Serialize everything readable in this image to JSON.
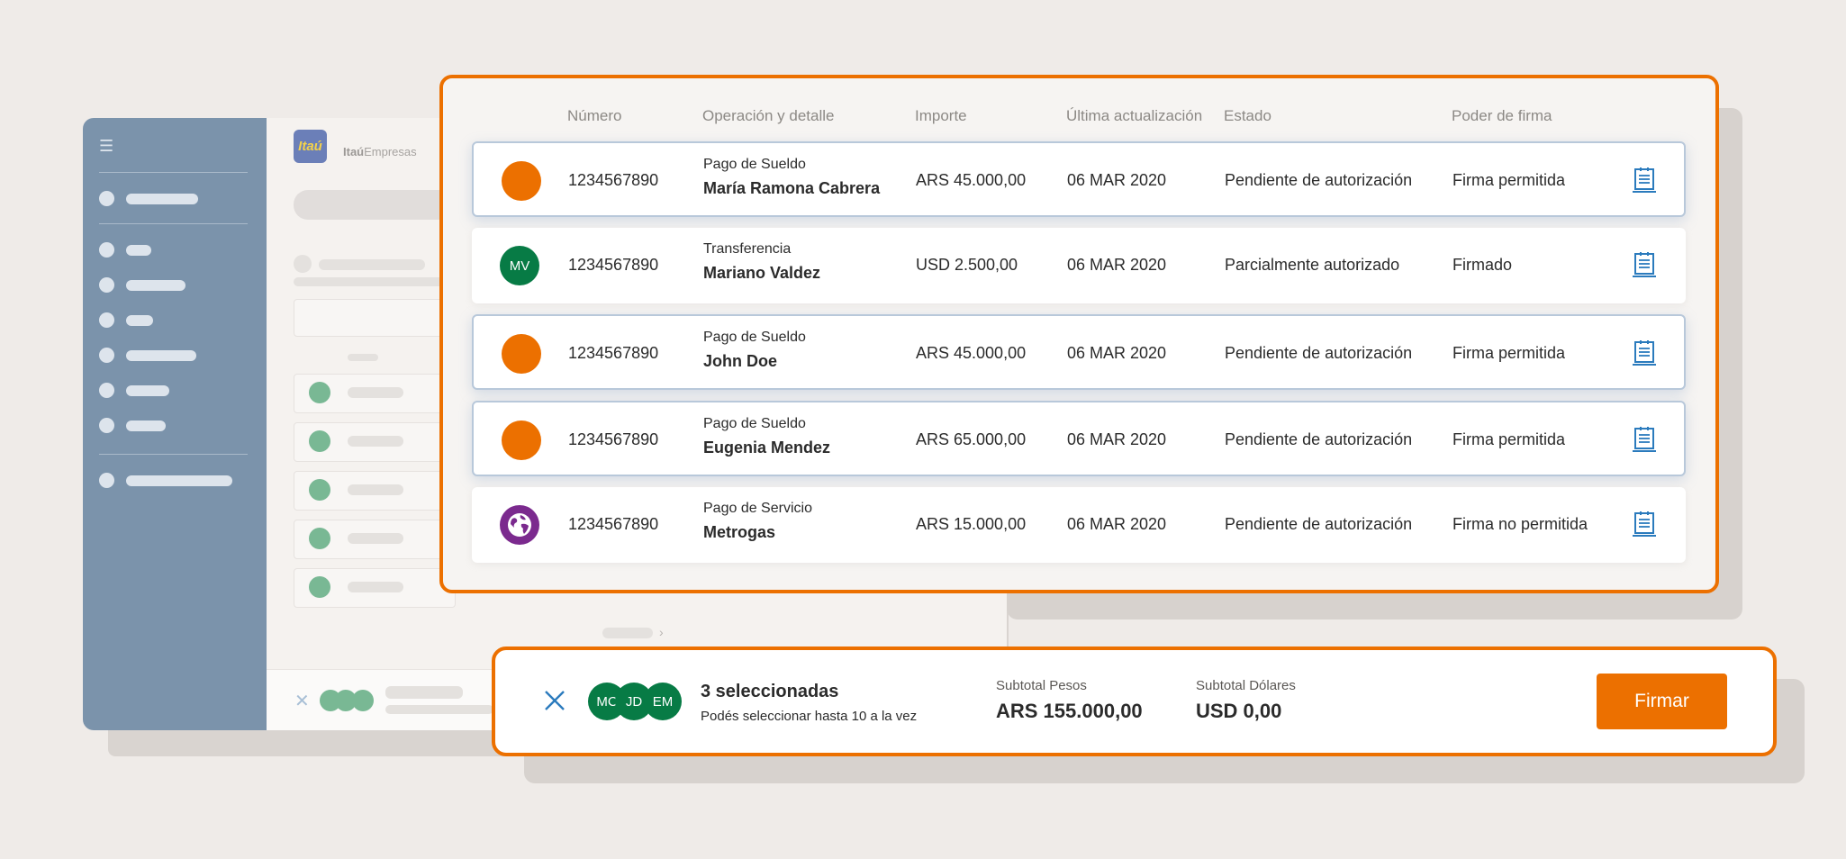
{
  "colors": {
    "brand_orange": "#ec7000",
    "avatar_green": "#077b45",
    "avatar_purple": "#7b2a8e",
    "link_blue": "#2b7bbd",
    "sidebar_blue": "#7b93ab"
  },
  "background_app": {
    "menu_icon": "hamburger-icon",
    "logo": "Itaú",
    "brand_text_bold": "Itaú",
    "brand_text": "Empresas"
  },
  "table": {
    "headers": [
      "Número",
      "Operación y detalle",
      "Importe",
      "Última actualización",
      "Estado",
      "Poder de firma"
    ],
    "rows": [
      {
        "selected": true,
        "avatar": "",
        "avatar_color": "orange",
        "numero": "1234567890",
        "operacion": "Pago de Sueldo",
        "detalle": "María Ramona Cabrera",
        "importe": "ARS 45.000,00",
        "fecha": "06 MAR 2020",
        "estado": "Pendiente de autorización",
        "poder": "Firma permitida",
        "icon": "document-icon"
      },
      {
        "selected": false,
        "avatar": "MV",
        "avatar_color": "green",
        "numero": "1234567890",
        "operacion": "Transferencia",
        "detalle": "Mariano Valdez",
        "importe": "USD 2.500,00",
        "fecha": "06 MAR 2020",
        "estado": "Parcialmente autorizado",
        "poder": "Firmado",
        "icon": "document-icon"
      },
      {
        "selected": true,
        "avatar": "",
        "avatar_color": "orange",
        "numero": "1234567890",
        "operacion": "Pago de Sueldo",
        "detalle": "John Doe",
        "importe": "ARS 45.000,00",
        "fecha": "06 MAR 2020",
        "estado": "Pendiente de autorización",
        "poder": "Firma permitida",
        "icon": "document-icon"
      },
      {
        "selected": true,
        "avatar": "",
        "avatar_color": "orange",
        "numero": "1234567890",
        "operacion": "Pago de Sueldo",
        "detalle": "Eugenia Mendez",
        "importe": "ARS 65.000,00",
        "fecha": "06 MAR 2020",
        "estado": "Pendiente de autorización",
        "poder": "Firma permitida",
        "icon": "document-icon"
      },
      {
        "selected": false,
        "avatar": "",
        "avatar_icon": "globe-icon",
        "avatar_color": "purple",
        "numero": "1234567890",
        "operacion": "Pago de Servicio",
        "detalle": "Metrogas",
        "importe": "ARS 15.000,00",
        "fecha": "06 MAR 2020",
        "estado": "Pendiente de autorización",
        "poder": "Firma no permitida",
        "icon": "document-icon"
      }
    ]
  },
  "selection_bar": {
    "close_icon": "close-icon",
    "avatars": [
      "MC",
      "JD",
      "EM"
    ],
    "title": "3 seleccionadas",
    "subtitle": "Podés seleccionar hasta 10 a la vez",
    "subtotal_pesos_label": "Subtotal Pesos",
    "subtotal_pesos_value": "ARS 155.000,00",
    "subtotal_dolares_label": "Subtotal Dólares",
    "subtotal_dolares_value": "USD 0,00",
    "button_label": "Firmar"
  }
}
